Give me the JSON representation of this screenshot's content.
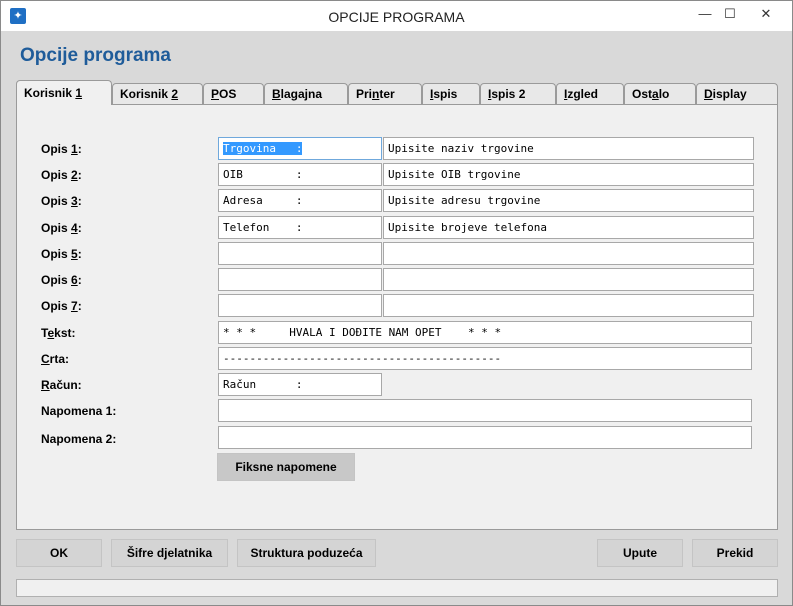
{
  "window": {
    "title": "OPCIJE PROGRAMA",
    "app_icon": "star-icon",
    "controls": {
      "minimize": "—",
      "maximize": "☐",
      "close": "✕"
    }
  },
  "page_title": "Opcije programa",
  "tabs": [
    {
      "pre": "Korisnik ",
      "u": "1",
      "post": "",
      "active": true
    },
    {
      "pre": "Korisnik ",
      "u": "2",
      "post": ""
    },
    {
      "pre": "",
      "u": "P",
      "post": "OS"
    },
    {
      "pre": "",
      "u": "B",
      "post": "lagajna"
    },
    {
      "pre": "Pri",
      "u": "n",
      "post": "ter"
    },
    {
      "pre": "",
      "u": "I",
      "post": "spis"
    },
    {
      "pre": "",
      "u": "I",
      "post": "spis 2"
    },
    {
      "pre": "",
      "u": "I",
      "post": "zgled"
    },
    {
      "pre": "Ost",
      "u": "a",
      "post": "lo"
    },
    {
      "pre": "",
      "u": "D",
      "post": "isplay"
    }
  ],
  "fields": {
    "opis1": {
      "label_pre": "Opis ",
      "label_u": "1",
      "label_post": ":",
      "value_sel": "Trgovina   :",
      "desc": "Upisite naziv trgovine"
    },
    "opis2": {
      "label_pre": "Opis ",
      "label_u": "2",
      "label_post": ":",
      "value": "OIB        :",
      "desc": "Upisite OIB trgovine"
    },
    "opis3": {
      "label_pre": "Opis ",
      "label_u": "3",
      "label_post": ":",
      "value": "Adresa     :",
      "desc": "Upisite adresu trgovine"
    },
    "opis4": {
      "label_pre": "Opis ",
      "label_u": "4",
      "label_post": ":",
      "value": "Telefon    :",
      "desc": "Upisite brojeve telefona"
    },
    "opis5": {
      "label_pre": "Opis ",
      "label_u": "5",
      "label_post": ":",
      "value": "",
      "desc": ""
    },
    "opis6": {
      "label_pre": "Opis ",
      "label_u": "6",
      "label_post": ":",
      "value": "",
      "desc": ""
    },
    "opis7": {
      "label_pre": "Opis ",
      "label_u": "7",
      "label_post": ":",
      "value": "",
      "desc": ""
    },
    "tekst": {
      "label_pre": "T",
      "label_u": "e",
      "label_post": "kst:",
      "value": "* * *     HVALA I DOĐITE NAM OPET    * * *"
    },
    "crta": {
      "label_pre": "",
      "label_u": "C",
      "label_post": "rta:",
      "value": "------------------------------------------"
    },
    "racun": {
      "label_pre": "",
      "label_u": "R",
      "label_post": "ačun:",
      "value": "Račun      :"
    },
    "napomena1": {
      "label": "Napomena 1:",
      "value": ""
    },
    "napomena2": {
      "label": "Napomena 2:",
      "value": ""
    }
  },
  "buttons": {
    "fiksne": "Fiksne napomene",
    "ok": "OK",
    "sifre": "Šifre djelatnika",
    "struktura": "Struktura poduzeća",
    "upute": "Upute",
    "prekid": "Prekid"
  },
  "colors": {
    "title": "#1f5c9a",
    "selection": "#3399ff"
  }
}
